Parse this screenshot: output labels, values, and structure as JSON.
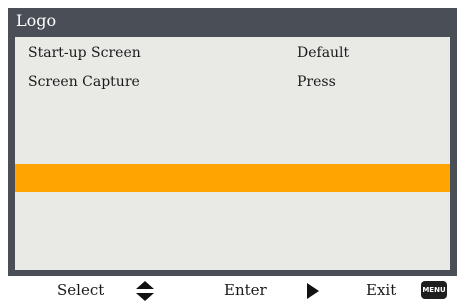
{
  "menu": {
    "title": "Logo",
    "items": [
      {
        "label": "Start-up Screen",
        "value": "Default"
      },
      {
        "label": "Screen Capture",
        "value": "Press"
      }
    ]
  },
  "colors": {
    "frame": "#4a4f57",
    "panel": "#e9e9e5",
    "highlight": "#ffa400"
  },
  "footer": {
    "select_label": "Select",
    "enter_label": "Enter",
    "exit_label": "Exit",
    "select_icon": "up-down-arrows-icon",
    "enter_icon": "play-icon",
    "exit_icon": "menu-key-icon",
    "menu_key_text": "MENU"
  }
}
